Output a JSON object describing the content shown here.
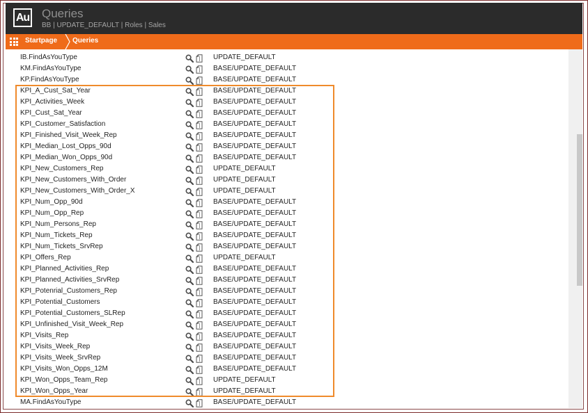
{
  "header": {
    "logo": "Au",
    "title": "Queries",
    "subtitle": "BB | UPDATE_DEFAULT | Roles | Sales"
  },
  "breadcrumb": {
    "items": [
      {
        "label": "Startpage"
      },
      {
        "label": "Queries"
      }
    ]
  },
  "colors": {
    "header_bg": "#2b2b2b",
    "accent": "#ef6b1a",
    "highlight_border": "#ef8a2b"
  },
  "icons": [
    "grid-icon",
    "search-icon",
    "document-icon"
  ],
  "queries": [
    {
      "name": "IB.FindAsYouType",
      "layer": "UPDATE_DEFAULT"
    },
    {
      "name": "KM.FindAsYouType",
      "layer": "BASE/UPDATE_DEFAULT"
    },
    {
      "name": "KP.FindAsYouType",
      "layer": "BASE/UPDATE_DEFAULT"
    },
    {
      "name": "KPI_A_Cust_Sat_Year",
      "layer": "BASE/UPDATE_DEFAULT"
    },
    {
      "name": "KPI_Activities_Week",
      "layer": "BASE/UPDATE_DEFAULT"
    },
    {
      "name": "KPI_Cust_Sat_Year",
      "layer": "BASE/UPDATE_DEFAULT"
    },
    {
      "name": "KPI_Customer_Satisfaction",
      "layer": "BASE/UPDATE_DEFAULT"
    },
    {
      "name": "KPI_Finished_Visit_Week_Rep",
      "layer": "BASE/UPDATE_DEFAULT"
    },
    {
      "name": "KPI_Median_Lost_Opps_90d",
      "layer": "BASE/UPDATE_DEFAULT"
    },
    {
      "name": "KPI_Median_Won_Opps_90d",
      "layer": "BASE/UPDATE_DEFAULT"
    },
    {
      "name": "KPI_New_Customers_Rep",
      "layer": "UPDATE_DEFAULT"
    },
    {
      "name": "KPI_New_Customers_With_Order",
      "layer": "UPDATE_DEFAULT"
    },
    {
      "name": "KPI_New_Customers_With_Order_X",
      "layer": "UPDATE_DEFAULT"
    },
    {
      "name": "KPI_Num_Opp_90d",
      "layer": "BASE/UPDATE_DEFAULT"
    },
    {
      "name": "KPI_Num_Opp_Rep",
      "layer": "BASE/UPDATE_DEFAULT"
    },
    {
      "name": "KPI_Num_Persons_Rep",
      "layer": "BASE/UPDATE_DEFAULT"
    },
    {
      "name": "KPI_Num_Tickets_Rep",
      "layer": "BASE/UPDATE_DEFAULT"
    },
    {
      "name": "KPI_Num_Tickets_SrvRep",
      "layer": "BASE/UPDATE_DEFAULT"
    },
    {
      "name": "KPI_Offers_Rep",
      "layer": "UPDATE_DEFAULT"
    },
    {
      "name": "KPI_Planned_Activities_Rep",
      "layer": "BASE/UPDATE_DEFAULT"
    },
    {
      "name": "KPI_Planned_Activities_SrvRep",
      "layer": "BASE/UPDATE_DEFAULT"
    },
    {
      "name": "KPI_Potenrial_Customers_Rep",
      "layer": "BASE/UPDATE_DEFAULT"
    },
    {
      "name": "KPI_Potential_Customers",
      "layer": "BASE/UPDATE_DEFAULT"
    },
    {
      "name": "KPI_Potential_Customers_SLRep",
      "layer": "BASE/UPDATE_DEFAULT"
    },
    {
      "name": "KPI_Unfinished_Visit_Week_Rep",
      "layer": "BASE/UPDATE_DEFAULT"
    },
    {
      "name": "KPI_Visits_Rep",
      "layer": "BASE/UPDATE_DEFAULT"
    },
    {
      "name": "KPI_Visits_Week_Rep",
      "layer": "BASE/UPDATE_DEFAULT"
    },
    {
      "name": "KPI_Visits_Week_SrvRep",
      "layer": "BASE/UPDATE_DEFAULT"
    },
    {
      "name": "KPI_Visits_Won_Opps_12M",
      "layer": "BASE/UPDATE_DEFAULT"
    },
    {
      "name": "KPI_Won_Opps_Team_Rep",
      "layer": "UPDATE_DEFAULT"
    },
    {
      "name": "KPI_Won_Opps_Year",
      "layer": "UPDATE_DEFAULT"
    },
    {
      "name": "MA.FindAsYouType",
      "layer": "BASE/UPDATE_DEFAULT"
    }
  ]
}
